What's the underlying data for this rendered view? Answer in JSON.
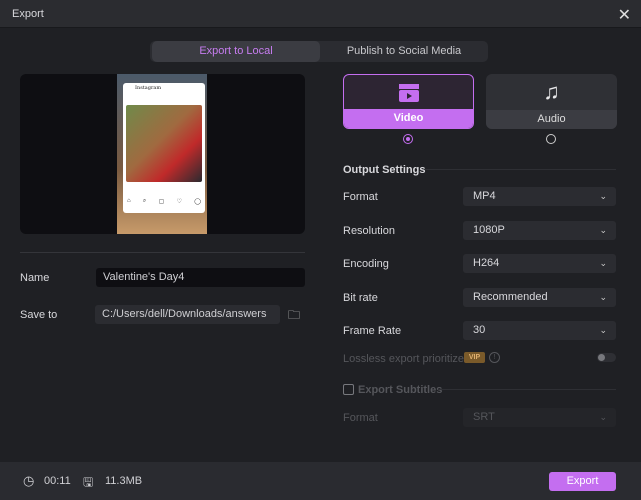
{
  "window": {
    "title": "Export",
    "close_icon": "close-icon"
  },
  "tabs": [
    {
      "label": "Export to Local",
      "active": true
    },
    {
      "label": "Publish to Social Media",
      "active": false
    }
  ],
  "preview": {
    "app_label": "Instagram"
  },
  "name": {
    "label": "Name",
    "value": "Valentine's Day4"
  },
  "save_to": {
    "label": "Save to",
    "value": "C:/Users/dell/Downloads/answers",
    "icon": "folder-icon"
  },
  "modes": [
    {
      "label": "Video",
      "icon": "video-clapper-icon",
      "selected": true
    },
    {
      "label": "Audio",
      "icon": "music-note-icon",
      "selected": false
    }
  ],
  "output_settings": {
    "title": "Output Settings",
    "rows": [
      {
        "label": "Format",
        "value": "MP4"
      },
      {
        "label": "Resolution",
        "value": "1080P"
      },
      {
        "label": "Encoding",
        "value": "H264"
      },
      {
        "label": "Bit rate",
        "value": "Recommended"
      },
      {
        "label": "Frame Rate",
        "value": "30"
      }
    ],
    "lossless": {
      "label": "Lossless export prioritized",
      "badge": "VIP",
      "enabled": false
    }
  },
  "subtitles": {
    "label": "Export Subtitles",
    "checked": false,
    "format_label": "Format",
    "format_value": "SRT"
  },
  "footer": {
    "duration": "00:11",
    "size": "11.3MB",
    "export_label": "Export"
  },
  "colors": {
    "accent": "#c46ef0",
    "background": "#1f2024"
  }
}
